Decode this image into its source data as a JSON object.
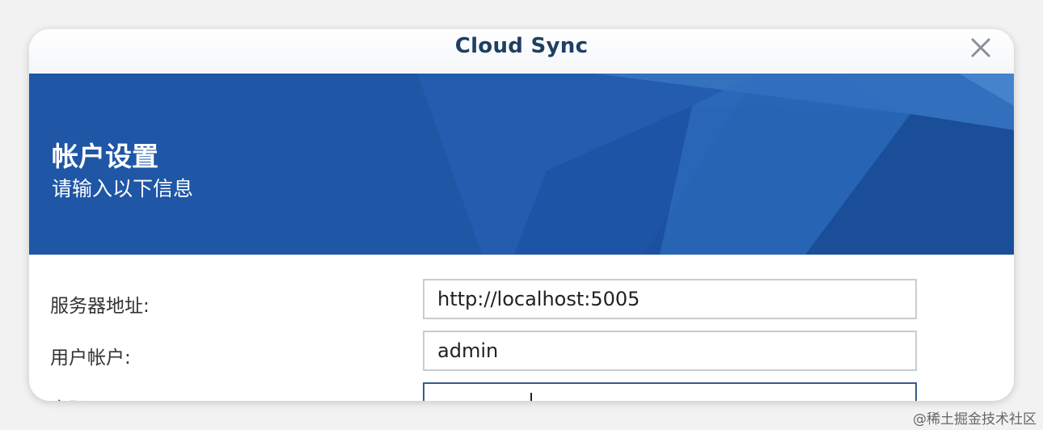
{
  "window": {
    "title": "Cloud Sync"
  },
  "banner": {
    "title": "帐户设置",
    "subtitle": "请输入以下信息"
  },
  "form": {
    "server_label": "服务器地址:",
    "server_value": "http://localhost:5005",
    "account_label": "用户帐户:",
    "account_value": "admin",
    "password_label": "密码:",
    "password_value": ""
  },
  "watermark": "@稀土掘金技术社区",
  "colors": {
    "title": "#1f3f63",
    "banner": "#1f56a6",
    "input_border": "#c8ccd3",
    "input_focus_border": "#3a5a8a"
  },
  "icons": {
    "close": "close-icon"
  }
}
